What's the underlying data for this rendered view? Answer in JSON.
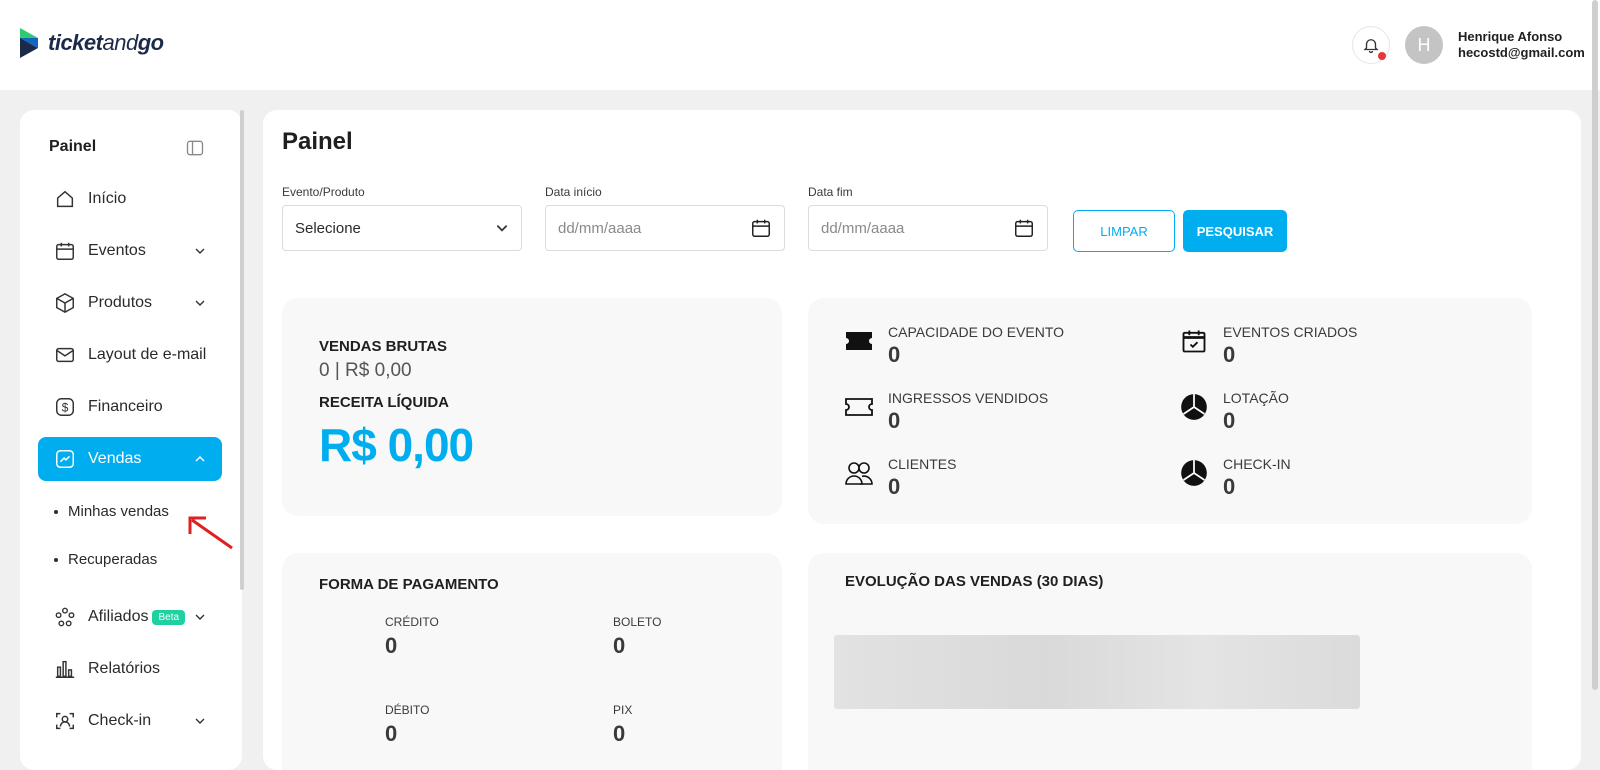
{
  "header": {
    "logo_bold": "ticket",
    "logo_light": "and",
    "logo_bold2": "go",
    "avatar_initial": "H",
    "user_name": "Henrique Afonso",
    "user_email": "hecostd@gmail.com"
  },
  "sidebar": {
    "title": "Painel",
    "items": [
      {
        "label": "Início",
        "icon": "home-icon"
      },
      {
        "label": "Eventos",
        "icon": "calendar-icon"
      },
      {
        "label": "Produtos",
        "icon": "box-icon"
      },
      {
        "label": "Layout de e-mail",
        "icon": "mail-edit-icon"
      },
      {
        "label": "Financeiro",
        "icon": "dollar-icon"
      },
      {
        "label": "Vendas",
        "icon": "trend-icon"
      },
      {
        "label": "Afiliados",
        "icon": "network-icon",
        "badge": "Beta"
      },
      {
        "label": "Relatórios",
        "icon": "bar-chart-icon"
      },
      {
        "label": "Check-in",
        "icon": "face-scan-icon"
      }
    ],
    "sub_items": [
      "Minhas vendas",
      "Recuperadas"
    ]
  },
  "main": {
    "title": "Painel",
    "filters": {
      "event_label": "Evento/Produto",
      "event_value": "Selecione",
      "start_label": "Data início",
      "start_placeholder": "dd/mm/aaaa",
      "end_label": "Data fim",
      "end_placeholder": "dd/mm/aaaa",
      "clear_label": "LIMPAR",
      "search_label": "PESQUISAR"
    },
    "sales": {
      "gross_label": "VENDAS BRUTAS",
      "gross_value": "0 | R$ 0,00",
      "net_label": "RECEITA LÍQUIDA",
      "net_value": "R$ 0,00"
    },
    "stats": [
      {
        "label": "CAPACIDADE DO EVENTO",
        "value": "0",
        "icon": "ticket-filled-icon"
      },
      {
        "label": "EVENTOS CRIADOS",
        "value": "0",
        "icon": "calendar-check-icon"
      },
      {
        "label": "INGRESSOS VENDIDOS",
        "value": "0",
        "icon": "ticket-outline-icon"
      },
      {
        "label": "LOTAÇÃO",
        "value": "0",
        "icon": "pie-icon"
      },
      {
        "label": "CLIENTES",
        "value": "0",
        "icon": "users-icon"
      },
      {
        "label": "CHECK-IN",
        "value": "0",
        "icon": "pie-icon"
      }
    ],
    "payment": {
      "title": "FORMA DE PAGAMENTO",
      "items": [
        {
          "label": "CRÉDITO",
          "value": "0"
        },
        {
          "label": "BOLETO",
          "value": "0"
        },
        {
          "label": "DÉBITO",
          "value": "0"
        },
        {
          "label": "PIX",
          "value": "0"
        }
      ]
    },
    "evolution": {
      "title": "EVOLUÇÃO DAS VENDAS (30 DIAS)"
    }
  },
  "colors": {
    "accent": "#00aef0",
    "beta": "#1fd0a0",
    "notification": "#e53935",
    "annotation_arrow": "#e02020"
  }
}
